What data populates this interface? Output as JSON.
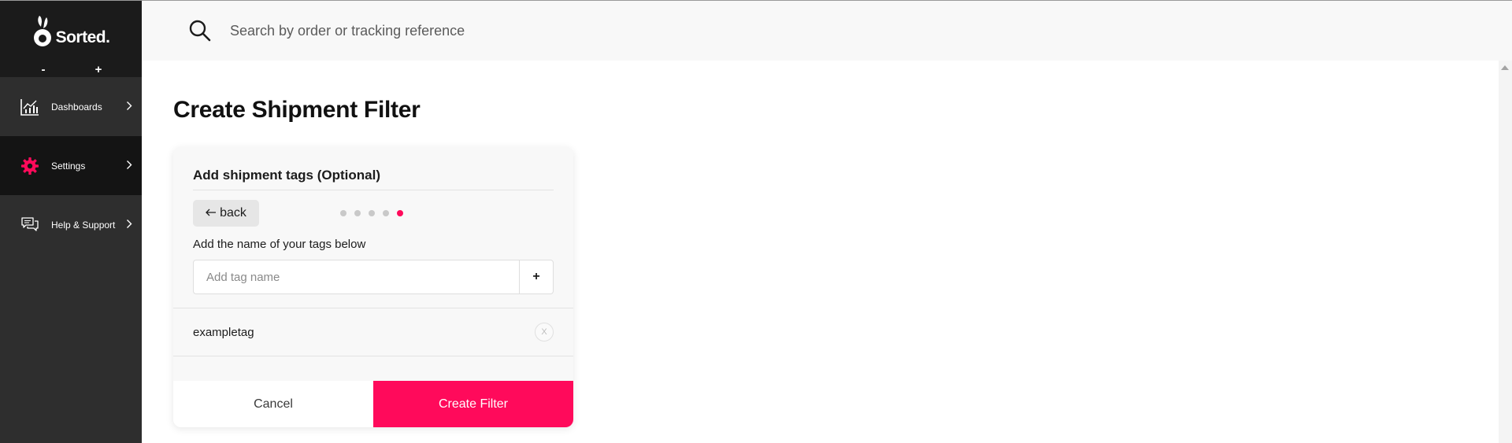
{
  "brand": {
    "name": "Sorted.",
    "accent": "#ff0a5b"
  },
  "zoom": {
    "minus": "-",
    "plus": "+"
  },
  "sidebar": {
    "items": [
      {
        "label": "Dashboards",
        "icon": "chart-icon",
        "active": false
      },
      {
        "label": "Settings",
        "icon": "gear-icon",
        "active": true
      },
      {
        "label": "Help & Support",
        "icon": "chat-icon",
        "active": false
      }
    ]
  },
  "search": {
    "placeholder": "Search by order or tracking reference",
    "value": ""
  },
  "page": {
    "title": "Create Shipment Filter"
  },
  "card": {
    "title": "Add shipment tags (Optional)",
    "back_label": "back",
    "steps_total": 5,
    "current_step": 5,
    "field_label": "Add the name of your tags below",
    "tag_input_placeholder": "Add tag name",
    "add_label": "+",
    "tags": [
      "exampletag"
    ],
    "remove_label": "X",
    "cancel_label": "Cancel",
    "create_label": "Create Filter"
  }
}
